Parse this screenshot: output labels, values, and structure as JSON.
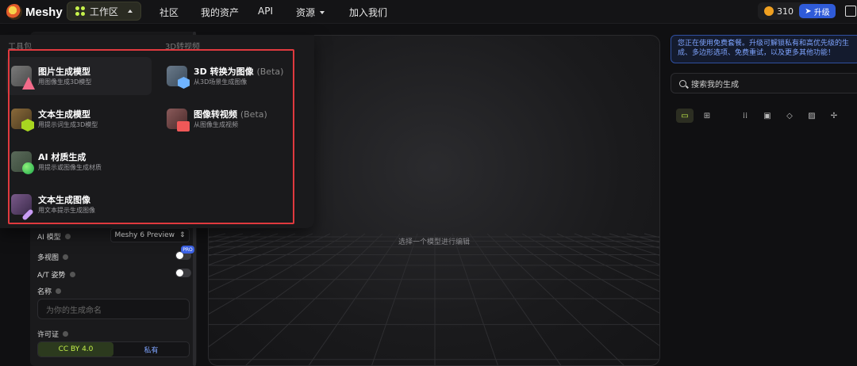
{
  "brand": {
    "name": "Meshy"
  },
  "nav": {
    "workspace": "工作区",
    "community": "社区",
    "assets": "我的资产",
    "api": "API",
    "resources": "资源",
    "join": "加入我们"
  },
  "account": {
    "credits": "310",
    "upgrade": "升级"
  },
  "dropdown": {
    "col1_heading": "工具包",
    "col2_heading": "3D转视频",
    "items": [
      {
        "title": "图片生成模型",
        "beta": "",
        "sub": "用图像生成3D模型",
        "icon": "image-to-3d-icon"
      },
      {
        "title": "文本生成模型",
        "beta": "",
        "sub": "用提示词生成3D模型",
        "icon": "text-to-3d-icon"
      },
      {
        "title": "AI 材质生成",
        "beta": "",
        "sub": "用提示或图像生成材质",
        "icon": "ai-texture-icon"
      },
      {
        "title": "文本生成图像",
        "beta": "",
        "sub": "用文本提示生成图像",
        "icon": "text-to-image-icon"
      },
      {
        "title": "3D 转换为图像",
        "beta": "(Beta)",
        "sub": "从3D场景生成图像",
        "icon": "3d-to-image-icon"
      },
      {
        "title": "图像转视频",
        "beta": "(Beta)",
        "sub": "从图像生成视频",
        "icon": "image-to-video-icon"
      }
    ]
  },
  "form": {
    "ai_model_label": "AI 模型",
    "ai_model_value": "Meshy 6 Preview",
    "multiview_label": "多视图",
    "pro_badge": "PRO",
    "atpose_label": "A/T 姿势",
    "name_label": "名称",
    "name_placeholder": "为你的生成命名",
    "license_label": "许可证",
    "license_options": [
      "CC BY 4.0",
      "私有"
    ],
    "license_selected": "CC BY 4.0"
  },
  "viewport": {
    "hint": "选择一个模型进行编辑"
  },
  "right": {
    "notice": "您正在使用免费套餐。升级可解锁私有和高优先级的生成、多边形选项、免费重试，以及更多其他功能！",
    "search_label": "搜索我的生成",
    "filters": [
      "folder-icon",
      "grid-icon",
      "all-icon",
      "image-icon",
      "cube-icon",
      "texture-icon",
      "animation-icon"
    ]
  },
  "colors": {
    "accent": "#c6f24b",
    "upgrade": "#2f5bd8",
    "highlight": "#e0393e",
    "notice": "#7ea4ff"
  }
}
